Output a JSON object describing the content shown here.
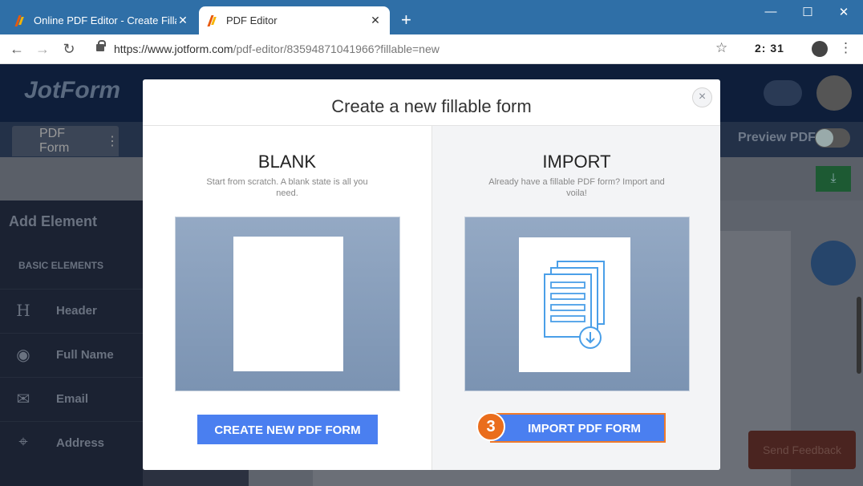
{
  "browser": {
    "tabs": [
      {
        "title": "Online PDF Editor - Create Fillabl",
        "close": "✕"
      },
      {
        "title": "PDF Editor",
        "close": "✕"
      }
    ],
    "new_tab": "+",
    "url_host": "https://www.jotform.com",
    "url_path": "/pdf-editor/83594871041966?fillable=new",
    "clock": "2:  31",
    "controls": {
      "minimize": "—",
      "maximize": "☐",
      "close": "✕"
    }
  },
  "app": {
    "logo": "JotForm",
    "form_tab": "PDF Form",
    "preview_label": "Preview PDF",
    "sidebar": {
      "title": "Add Element",
      "section": "BASIC ELEMENTS",
      "items": [
        {
          "icon": "H",
          "label": "Header"
        },
        {
          "icon": "◉",
          "label": "Full Name"
        },
        {
          "icon": "✉",
          "label": "Email"
        },
        {
          "icon": "⌖",
          "label": "Address"
        }
      ]
    },
    "feedback": "Send Feedback"
  },
  "modal": {
    "title": "Create a new fillable form",
    "close": "×",
    "blank": {
      "title": "BLANK",
      "description": "Start from scratch. A blank state is all you need.",
      "button": "CREATE NEW PDF FORM"
    },
    "import": {
      "title": "IMPORT",
      "description": "Already have a fillable PDF form? Import and voila!",
      "button": "IMPORT PDF FORM",
      "step": "3"
    }
  }
}
